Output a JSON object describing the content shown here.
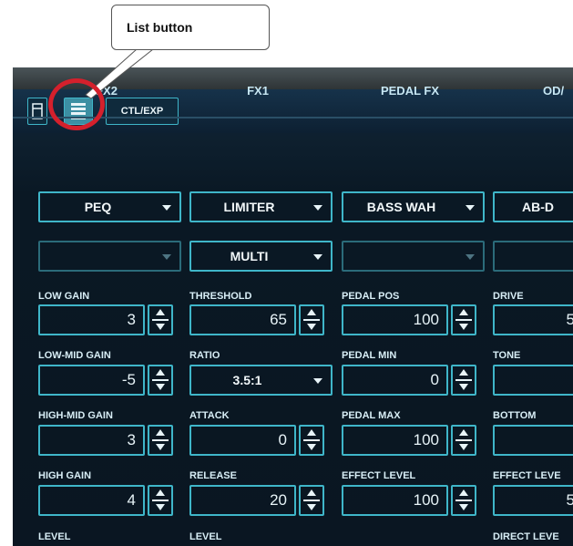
{
  "callout": {
    "label": "List button"
  },
  "toolbar": {
    "ctl_exp_label": "CTL/EXP"
  },
  "columns": [
    {
      "header": "FX2",
      "type": "PEQ",
      "subtype": ""
    },
    {
      "header": "FX1",
      "type": "LIMITER",
      "subtype": "MULTI"
    },
    {
      "header": "PEDAL FX",
      "type": "BASS WAH",
      "subtype": ""
    },
    {
      "header": "OD/",
      "type": "AB-D",
      "subtype": ""
    }
  ],
  "params": {
    "fx2": [
      {
        "label": "LOW GAIN",
        "value": "3"
      },
      {
        "label": "LOW-MID GAIN",
        "value": "-5"
      },
      {
        "label": "HIGH-MID GAIN",
        "value": "3"
      },
      {
        "label": "HIGH GAIN",
        "value": "4"
      },
      {
        "label": "LEVEL"
      }
    ],
    "fx1": [
      {
        "label": "THRESHOLD",
        "value": "65"
      },
      {
        "label": "RATIO",
        "value": "3.5:1"
      },
      {
        "label": "ATTACK",
        "value": "0"
      },
      {
        "label": "RELEASE",
        "value": "20"
      },
      {
        "label": "LEVEL"
      }
    ],
    "pedal": [
      {
        "label": "PEDAL POS",
        "value": "100"
      },
      {
        "label": "PEDAL MIN",
        "value": "0"
      },
      {
        "label": "PEDAL MAX",
        "value": "100"
      },
      {
        "label": "EFFECT LEVEL",
        "value": "100"
      }
    ],
    "od": [
      {
        "label": "DRIVE",
        "value": "5"
      },
      {
        "label": "TONE",
        "value": ""
      },
      {
        "label": "BOTTOM",
        "value": ""
      },
      {
        "label": "EFFECT LEVE",
        "value": "5"
      },
      {
        "label": "DIRECT LEVE"
      }
    ]
  },
  "colors": {
    "accent": "#3fb6c9",
    "highlight_ring": "#d4202c",
    "background": "#0a1824"
  }
}
